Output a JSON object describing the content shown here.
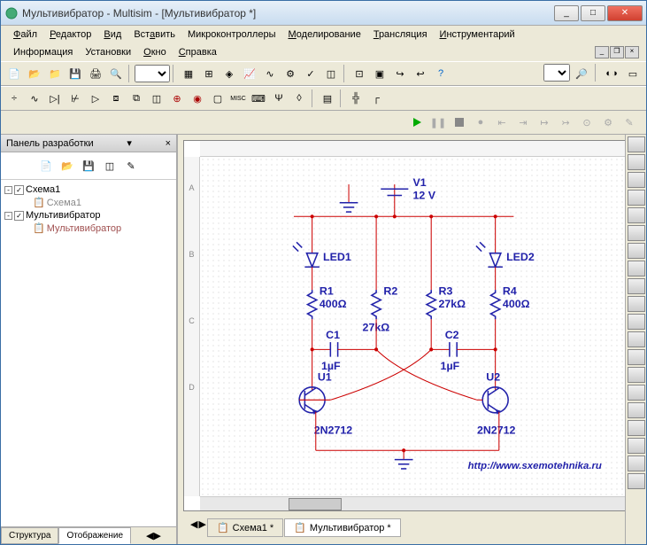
{
  "title": "Мультивибратор - Multisim - [Мультивибратор *]",
  "menu": {
    "file": "Файл",
    "edit": "Редактор",
    "view": "Вид",
    "insert": "Вставить",
    "mcu": "Микроконтроллеры",
    "sim": "Моделирование",
    "transfer": "Трансляция",
    "tools": "Инструментарий",
    "info": "Информация",
    "settings": "Установки",
    "window": "Окно",
    "help": "Справка"
  },
  "sidebar": {
    "title": "Панель разработки",
    "tree": {
      "root1": "Схема1",
      "child1": "Схема1",
      "root2": "Мультивибратор",
      "child2": "Мультивибратор"
    },
    "tabs": {
      "structure": "Структура",
      "display": "Отображение"
    }
  },
  "doctabs": {
    "tab1": "Схема1 *",
    "tab2": "Мультивибратор *"
  },
  "circuit": {
    "v1_name": "V1",
    "v1_val": "12 V",
    "led1": "LED1",
    "led2": "LED2",
    "r1_name": "R1",
    "r1_val": "400Ω",
    "r2_name": "R2",
    "r2_val": "27kΩ",
    "r3_name": "R3",
    "r3_val": "27kΩ",
    "r4_name": "R4",
    "r4_val": "400Ω",
    "c1_name": "C1",
    "c1_val": "1µF",
    "c2_name": "C2",
    "c2_val": "1µF",
    "u1": "U1",
    "u2": "U2",
    "q1": "2N2712",
    "q2": "2N2712",
    "url": "http://www.sxemotehnika.ru"
  },
  "ruler_v": [
    "A",
    "B",
    "C",
    "D"
  ]
}
